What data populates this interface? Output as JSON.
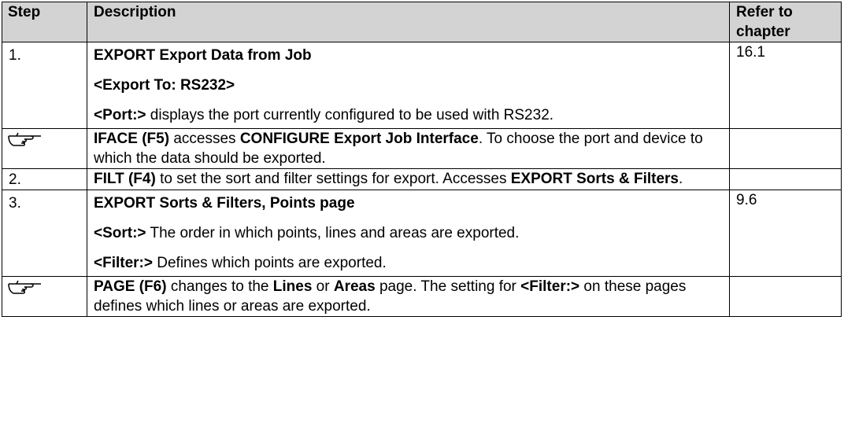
{
  "header": {
    "step": "Step",
    "description": "Description",
    "refer_to": "Refer to",
    "chapter": "chapter"
  },
  "rows": [
    {
      "step": "1.",
      "ref": "16.1",
      "line1": "EXPORT Export Data from Job",
      "line2": "<Export To: RS232>",
      "line3_bold": "<Port:>",
      "line3_rest": " displays the port currently configured to be used with RS232."
    },
    {
      "icon": "pointing-hand-icon",
      "p1": "IFACE (F5)",
      "p2": " accesses ",
      "p3": "CONFIGURE Export Job Interface",
      "p4": ". To choose the port and device to which the data should be exported."
    },
    {
      "step": "2.",
      "p1": "FILT (F4)",
      "p2": " to set the sort and filter settings for export. Accesses ",
      "p3": "EXPORT Sorts & Filters",
      "p4": "."
    },
    {
      "step": "3.",
      "ref": "9.6",
      "line1": "EXPORT Sorts & Filters, Points page",
      "line2_bold": "<Sort:>",
      "line2_rest": " The order in which points, lines and areas are exported.",
      "line3_bold": "<Filter:>",
      "line3_rest": " Defines which points are exported."
    },
    {
      "icon": "pointing-hand-icon",
      "p1": "PAGE (F6)",
      "p2": " changes to the ",
      "p3": "Lines",
      "p4": " or ",
      "p5": "Areas",
      "p6": " page. The setting for ",
      "p7": "<Filter:>",
      "p8": " on these pages defines which lines or areas are exported."
    }
  ]
}
